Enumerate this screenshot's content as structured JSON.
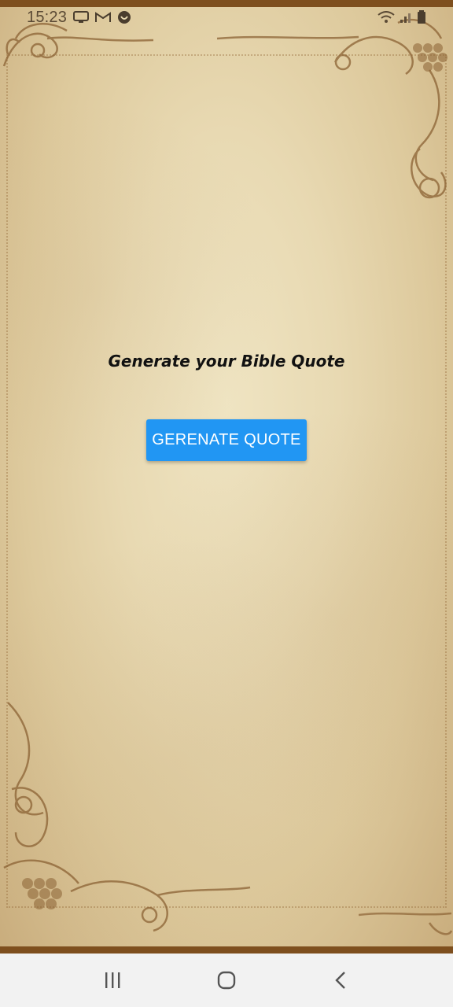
{
  "status_bar": {
    "time": "15:23",
    "left_icons": [
      "screen-icon",
      "gmail-icon",
      "app-icon"
    ],
    "right_icons": [
      "wifi-icon",
      "signal-icon",
      "battery-icon"
    ]
  },
  "main": {
    "title": "Generate your Bible Quote",
    "button_label": "GERENATE QUOTE",
    "button_color": "#2196f3"
  },
  "nav_bar": {
    "buttons": [
      "recent-apps-icon",
      "home-icon",
      "back-icon"
    ]
  }
}
